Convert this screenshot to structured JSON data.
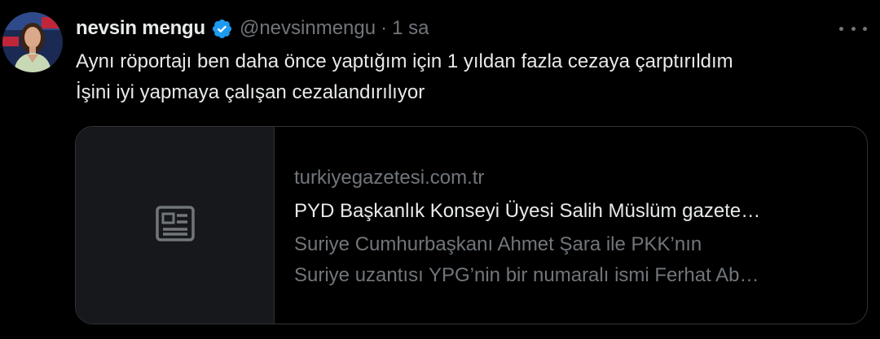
{
  "post": {
    "author": {
      "display_name": "nevsin mengu",
      "handle": "@nevsinmengu",
      "verified": true,
      "verified_color": "#1d9bf0"
    },
    "separator": "·",
    "time": "1 sa",
    "more_icon": "more-horizontal-icon",
    "text_lines": [
      "Aynı röportajı ben daha önce yaptığım için 1 yıldan fazla cezaya çarptırıldım",
      "İşini iyi yapmaya çalışan cezalandırılıyor"
    ],
    "link_card": {
      "media_icon": "article-icon",
      "domain": "turkiyegazetesi.com.tr",
      "title": "PYD Başkanlık Konseyi Üyesi Salih Müslüm gazete…",
      "description_lines": [
        "Suriye Cumhurbaşkanı Ahmet Şara ile PKK’nın",
        "Suriye uzantısı YPG’nin bir numaralı ismi Ferhat Ab…"
      ]
    }
  },
  "colors": {
    "background": "#000000",
    "primary_text": "#e7e9ea",
    "secondary_text": "#71767b",
    "border": "#2f3336",
    "card_media_bg": "#16181c"
  }
}
